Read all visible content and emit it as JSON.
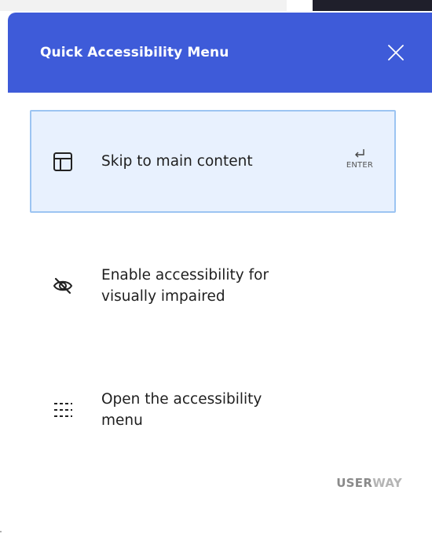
{
  "header": {
    "title": "Quick Accessibility Menu",
    "close_icon": "close-icon",
    "background_color": "#3e5bd9"
  },
  "items": [
    {
      "label": "Skip to main content",
      "icon": "layout-icon",
      "active": true,
      "shortcut_label": "ENTER",
      "shortcut_icon": "enter-key-icon"
    },
    {
      "label": "Enable accessibility for\nvisually impaired",
      "icon": "eye-slash-icon",
      "active": false
    },
    {
      "label": "Open the accessibility\nmenu",
      "icon": "dashed-menu-icon",
      "active": false
    }
  ],
  "brand": {
    "part1": "USER",
    "part2": "WAY"
  },
  "colors": {
    "active_bg": "#e8f1fe",
    "active_border": "#9cc4f2",
    "text": "#1f1f1f"
  }
}
